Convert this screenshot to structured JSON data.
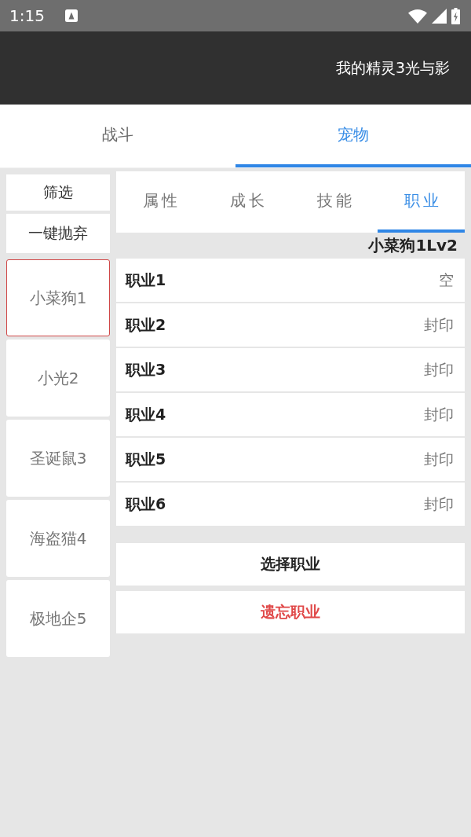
{
  "status_bar": {
    "time": "1:15"
  },
  "app_bar": {
    "title": "我的精灵3光与影"
  },
  "tabs": [
    {
      "label": "战斗",
      "selected": false
    },
    {
      "label": "宠物",
      "selected": true
    }
  ],
  "sidebar": {
    "actions": [
      "筛选",
      "一键抛弃"
    ],
    "pets": [
      {
        "name": "小菜狗1",
        "selected": true
      },
      {
        "name": "小光2",
        "selected": false
      },
      {
        "name": "圣诞鼠3",
        "selected": false
      },
      {
        "name": "海盗猫4",
        "selected": false
      },
      {
        "name": "极地企5",
        "selected": false
      }
    ]
  },
  "detail": {
    "tabs": [
      {
        "label": "属性",
        "selected": false
      },
      {
        "label": "成长",
        "selected": false
      },
      {
        "label": "技能",
        "selected": false
      },
      {
        "label": "职业",
        "selected": true
      }
    ],
    "pet_heading": "小菜狗1Lv2",
    "jobs": [
      {
        "label": "职业1",
        "value": "空"
      },
      {
        "label": "职业2",
        "value": "封印"
      },
      {
        "label": "职业3",
        "value": "封印"
      },
      {
        "label": "职业4",
        "value": "封印"
      },
      {
        "label": "职业5",
        "value": "封印"
      },
      {
        "label": "职业6",
        "value": "封印"
      }
    ],
    "buttons": [
      {
        "label": "选择职业",
        "kind": "primary"
      },
      {
        "label": "遗忘职业",
        "kind": "danger"
      }
    ]
  }
}
